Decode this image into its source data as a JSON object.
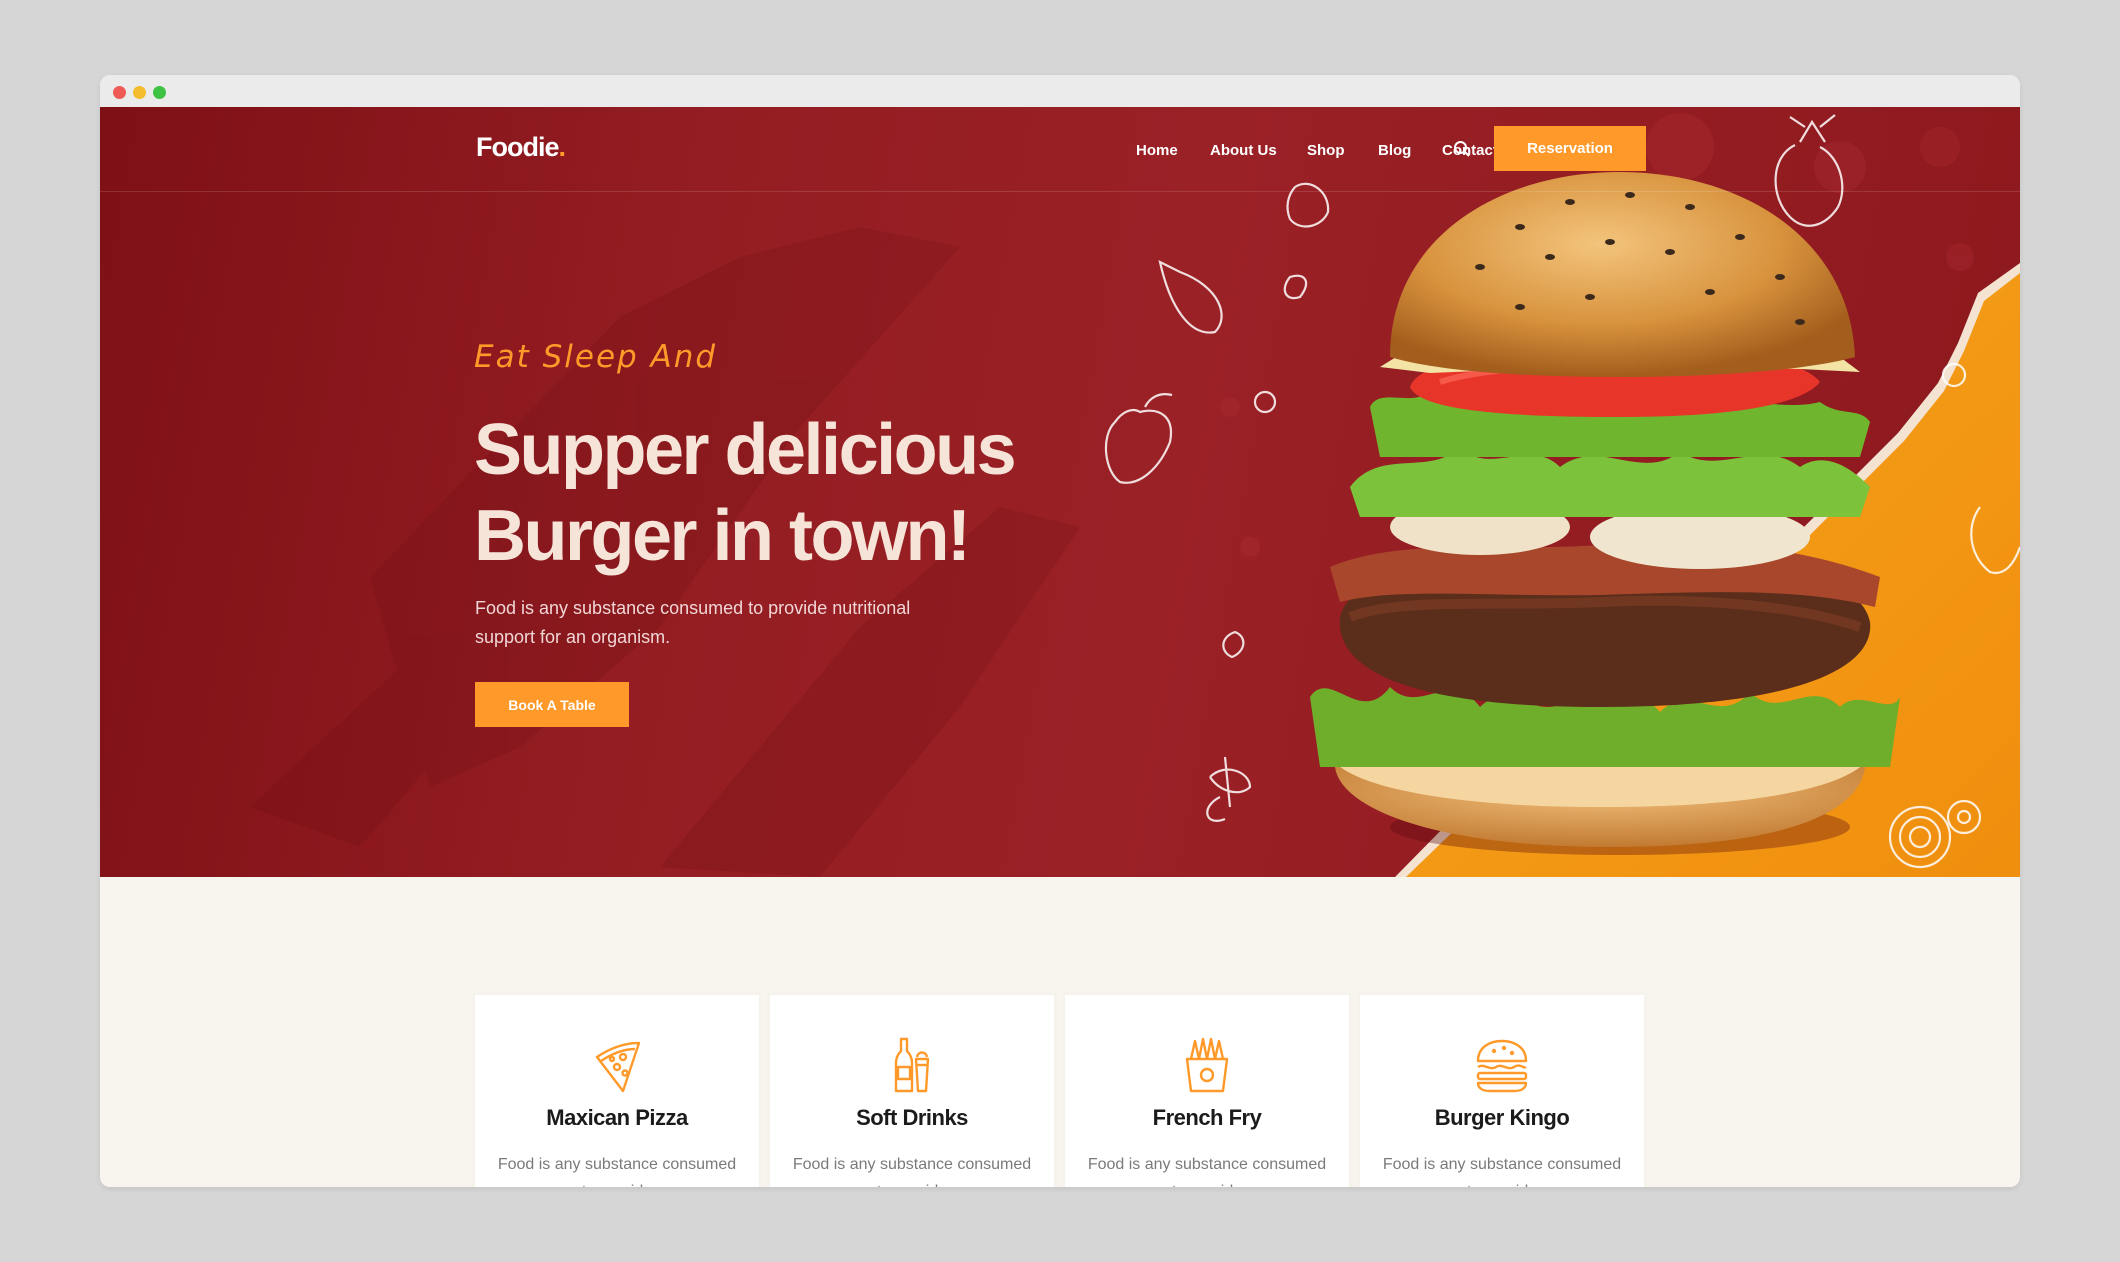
{
  "window": {
    "controls": [
      "close",
      "minimize",
      "maximize"
    ]
  },
  "brand": {
    "name": "Foodie",
    "dot": "."
  },
  "nav": {
    "items": [
      {
        "label": "Home"
      },
      {
        "label": "About Us"
      },
      {
        "label": "Shop"
      },
      {
        "label": "Blog"
      },
      {
        "label": "Contact Us"
      }
    ],
    "search_icon": "search-icon",
    "cta_label": "Reservation"
  },
  "hero": {
    "tagline": "Eat Sleep And",
    "headline_line1": "Supper delicious",
    "headline_line2": "Burger in town!",
    "description": "Food is any substance consumed to provide nutritional support for an organism.",
    "cta_label": "Book A Table"
  },
  "categories": [
    {
      "icon": "pizza-icon",
      "title": "Maxican Pizza",
      "text": "Food is any substance consumed to provide"
    },
    {
      "icon": "drinks-icon",
      "title": "Soft Drinks",
      "text": "Food is any substance consumed to provide"
    },
    {
      "icon": "fries-icon",
      "title": "French Fry",
      "text": "Food is any substance consumed to provide"
    },
    {
      "icon": "burger-icon",
      "title": "Burger Kingo",
      "text": "Food is any substance consumed to provide"
    }
  ],
  "colors": {
    "accent": "#ff9a2a",
    "hero_bg": "#931d22",
    "page_bg": "#f8f5ef"
  }
}
